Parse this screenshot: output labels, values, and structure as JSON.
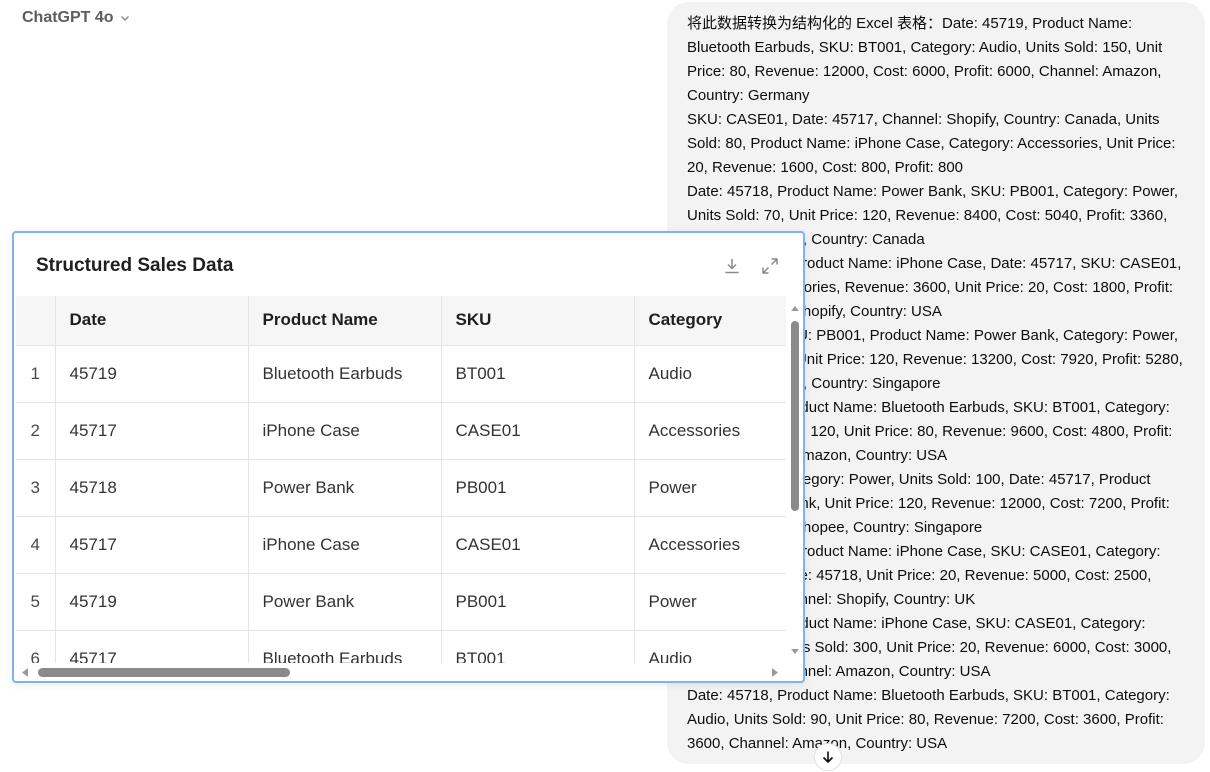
{
  "header": {
    "model_name": "ChatGPT 4o"
  },
  "message": {
    "text": "将此数据转换为结构化的 Excel 表格：Date: 45719, Product Name: Bluetooth Earbuds, SKU: BT001, Category: Audio, Units Sold: 150, Unit Price: 80, Revenue: 12000, Cost: 6000, Profit: 6000, Channel: Amazon, Country: Germany\nSKU: CASE01, Date: 45717, Channel: Shopify, Country: Canada, Units Sold: 80, Product Name: iPhone Case, Category: Accessories, Unit Price: 20, Revenue: 1600, Cost: 800, Profit: 800\nDate: 45718, Product Name: Power Bank, SKU: PB001, Category: Power, Units Sold: 70, Unit Price: 120, Revenue: 8400, Cost: 5040, Profit: 3360, Channel: Shopee, Country: Canada\nSKU: CASE01, Product Name: iPhone Case, Date: 45717, SKU: CASE01, Category: Accessories, Revenue: 3600, Unit Price: 20, Cost: 1800, Profit: 1800, Channel: Shopify, Country: USA\nDate: 45719, SKU: PB001, Product Name: Power Bank, Category: Power, Units Sold: 110, Unit Price: 120, Revenue: 13200, Cost: 7920, Profit: 5280, Channel: Shopee, Country: Singapore\nDate: 45717, Product Name: Bluetooth Earbuds, SKU: BT001, Category: Audio, Units Sold: 120, Unit Price: 80, Revenue: 9600, Cost: 4800, Profit: 4800, Channel: Amazon, Country: USA\nSKU: PB001, Category: Power, Units Sold: 100, Date: 45717, Product Name: Power Bank, Unit Price: 120, Revenue: 12000, Cost: 7200, Profit: 4800, Channel: Shopee, Country: Singapore\nSKU: CASE01, Product Name: iPhone Case, SKU: CASE01, Category: Accessories, Date: 45718, Unit Price: 20, Revenue: 5000, Cost: 2500, Profit: 2500, Channel: Shopify, Country: UK\nDate: 45719, Product Name: iPhone Case, SKU: CASE01, Category: Accessories, Units Sold: 300, Unit Price: 20, Revenue: 6000, Cost: 3000, Profit: 3000, Channel: Amazon, Country: USA\nDate: 45718, Product Name: Bluetooth Earbuds, SKU: BT001, Category: Audio, Units Sold: 90, Unit Price: 80, Revenue: 7200, Cost: 3600, Profit: 3600, Channel: Amazon, Country: USA"
  },
  "panel": {
    "title": "Structured Sales Data",
    "download_icon": "download-icon",
    "expand_icon": "expand-icon",
    "columns": [
      "Date",
      "Product Name",
      "SKU",
      "Category"
    ],
    "rows": [
      {
        "index": "1",
        "cells": [
          "45719",
          "Bluetooth Earbuds",
          "BT001",
          "Audio"
        ]
      },
      {
        "index": "2",
        "cells": [
          "45717",
          "iPhone Case",
          "CASE01",
          "Accessories"
        ]
      },
      {
        "index": "3",
        "cells": [
          "45718",
          "Power Bank",
          "PB001",
          "Power"
        ]
      },
      {
        "index": "4",
        "cells": [
          "45717",
          "iPhone Case",
          "CASE01",
          "Accessories"
        ]
      },
      {
        "index": "5",
        "cells": [
          "45719",
          "Power Bank",
          "PB001",
          "Power"
        ]
      },
      {
        "index": "6",
        "cells": [
          "45717",
          "Bluetooth Earbuds",
          "BT001",
          "Audio"
        ]
      }
    ]
  },
  "colors": {
    "panel_border": "#7fb2f0",
    "bubble_bg": "#f3f3f3"
  }
}
